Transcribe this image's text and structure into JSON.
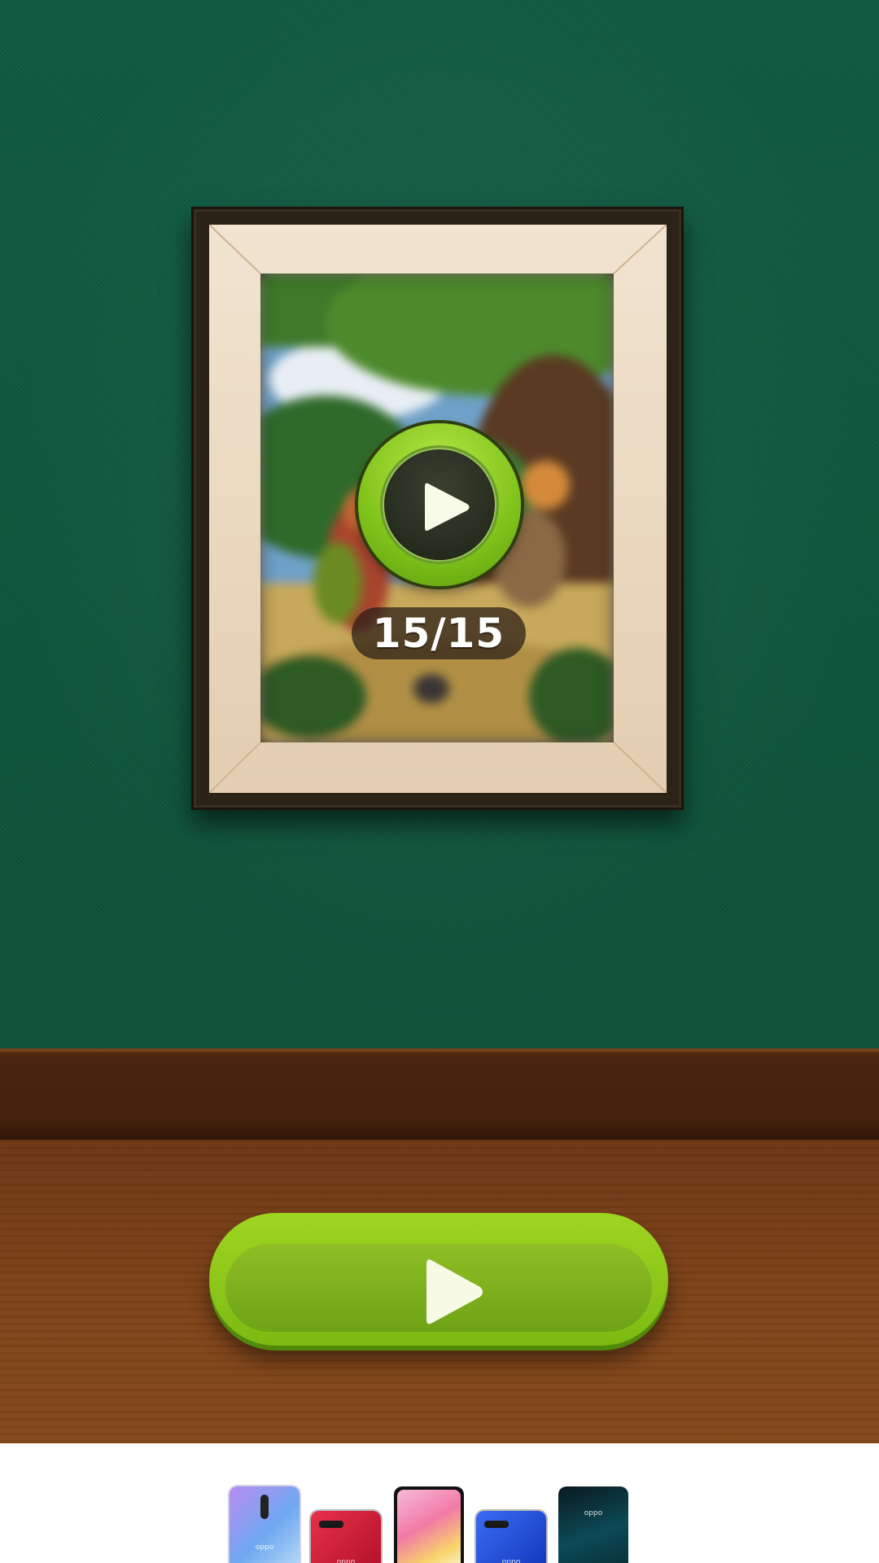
{
  "level": {
    "progress_text": "15/15",
    "completed": 15,
    "total": 15
  },
  "buttons": {
    "level_play_icon": "play-icon",
    "big_play_icon": "play-icon"
  },
  "ad": {
    "brand_text": "oppo"
  },
  "colors": {
    "wall": "#0f5b41",
    "frame": "#2b2218",
    "mat": "#ecdcc4",
    "play_green": "#8cc81a",
    "wood": "#7d4219"
  }
}
